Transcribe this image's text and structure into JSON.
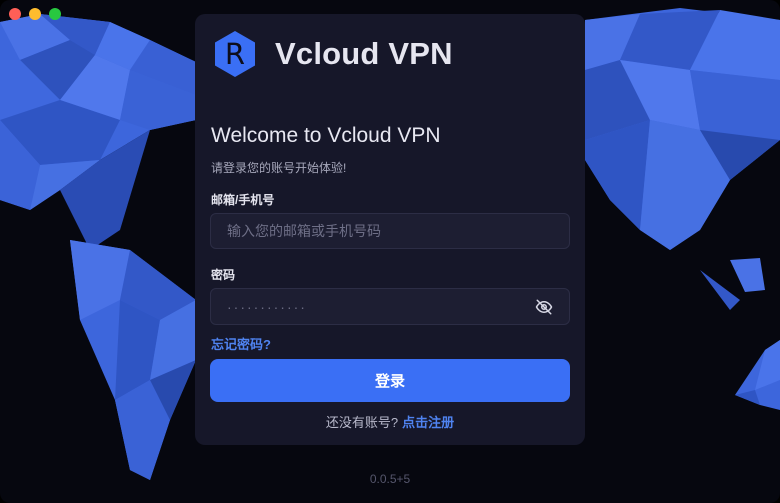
{
  "window": {
    "controls": [
      "close",
      "minimize",
      "zoom"
    ]
  },
  "brand": {
    "logo_letter": "R",
    "name": "Vcloud VPN"
  },
  "login": {
    "welcome": "Welcome to Vcloud VPN",
    "subtitle": "请登录您的账号开始体验!",
    "email_label": "邮箱/手机号",
    "email_placeholder": "输入您的邮箱或手机号码",
    "email_value": "",
    "password_label": "密码",
    "password_mask": "············",
    "forgot_label": "忘记密码?",
    "login_label": "登录",
    "no_account_text": "还没有账号?",
    "register_label": "点击注册"
  },
  "footer": {
    "version": "0.0.5+5"
  },
  "colors": {
    "accent": "#3a6ff5",
    "link": "#4f83f0",
    "map": "#3c64d8",
    "card": "#161729",
    "background": "#06070f"
  }
}
